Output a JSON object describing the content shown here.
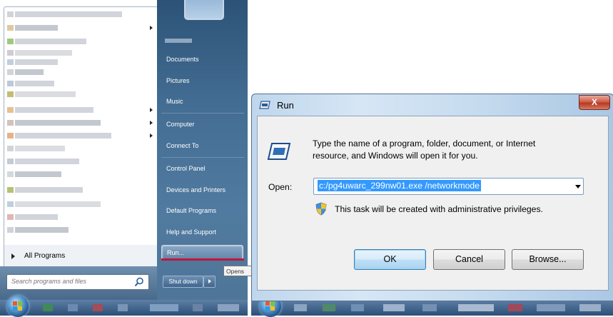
{
  "start_menu": {
    "right_pane": {
      "items": [
        {
          "label": "Documents"
        },
        {
          "label": "Pictures"
        },
        {
          "label": "Music"
        },
        {
          "label": "Computer"
        },
        {
          "label": "Connect To"
        },
        {
          "label": "Control Panel"
        },
        {
          "label": "Devices and Printers"
        },
        {
          "label": "Default Programs"
        },
        {
          "label": "Help and Support"
        },
        {
          "label": "Run..."
        }
      ]
    },
    "all_programs_label": "All Programs",
    "search": {
      "placeholder": "Search programs and files"
    },
    "shutdown_label": "Shut down",
    "tooltip_text": "Opens"
  },
  "run_dialog": {
    "title": "Run",
    "close_label": "X",
    "description_line1": "Type the name of a program, folder, document, or Internet",
    "description_line2": "resource, and Windows will open it for you.",
    "open_label": "Open:",
    "open_value": "c:/pg4uwarc_299nw01.exe /networkmode",
    "admin_notice": "This task will be created with administrative privileges.",
    "buttons": {
      "ok": "OK",
      "cancel": "Cancel",
      "browse": "Browse..."
    }
  },
  "colors": {
    "start_right_pane": "#446d93",
    "run_highlight": "#c5143a",
    "selection": "#3399ff",
    "close_button": "#c9503a"
  },
  "icons": [
    "search-icon",
    "run-icon",
    "shield-icon",
    "windows-orb-icon",
    "submenu-arrow-icon",
    "dropdown-arrow-icon"
  ]
}
